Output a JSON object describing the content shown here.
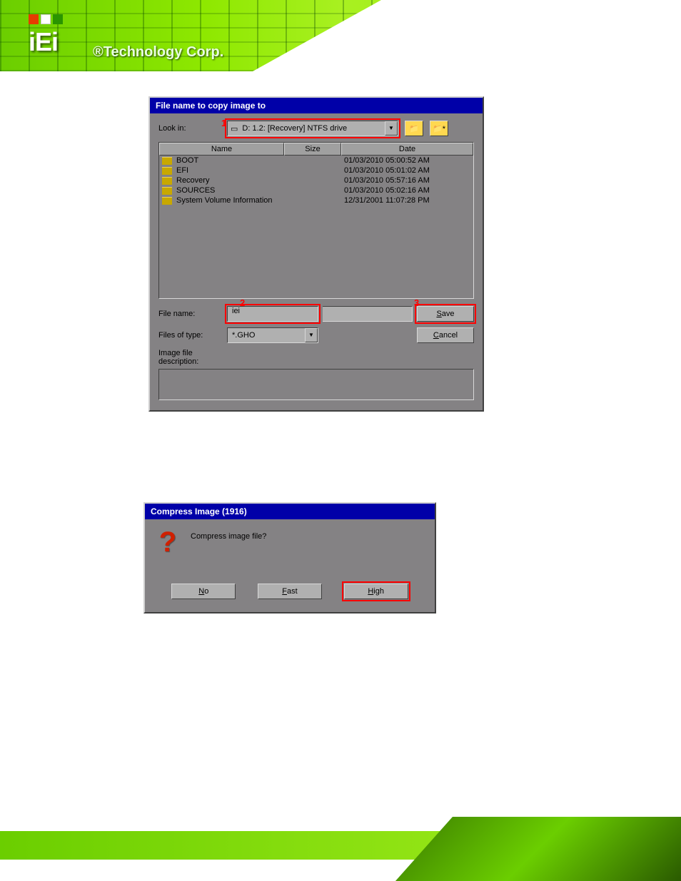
{
  "logo": {
    "iei": "iEi",
    "tagline": "®Technology Corp."
  },
  "dialog1": {
    "title": "File name to copy image to",
    "look_in_label": "Look in:",
    "look_in_value": "D: 1.2: [Recovery] NTFS drive",
    "annotations": {
      "a1": "1",
      "a2": "2",
      "a3": "3"
    },
    "columns": {
      "name": "Name",
      "size": "Size",
      "date": "Date"
    },
    "rows": [
      {
        "name": "BOOT",
        "size": "",
        "date": "01/03/2010 05:00:52 AM"
      },
      {
        "name": "EFI",
        "size": "",
        "date": "01/03/2010 05:01:02 AM"
      },
      {
        "name": "Recovery",
        "size": "",
        "date": "01/03/2010 05:57:16 AM"
      },
      {
        "name": "SOURCES",
        "size": "",
        "date": "01/03/2010 05:02:16 AM"
      },
      {
        "name": "System Volume Information",
        "size": "",
        "date": "12/31/2001 11:07:28 PM"
      }
    ],
    "file_name_label": "File name:",
    "file_name_value": "iei",
    "files_type_label": "Files of type:",
    "files_type_value": "*.GHO",
    "desc_label": "Image file description:",
    "save_btn": "Save",
    "cancel_btn": "Cancel"
  },
  "dialog2": {
    "title": "Compress Image (1916)",
    "question": "Compress image file?",
    "no_btn": "No",
    "fast_btn": "Fast",
    "high_btn": "High"
  }
}
